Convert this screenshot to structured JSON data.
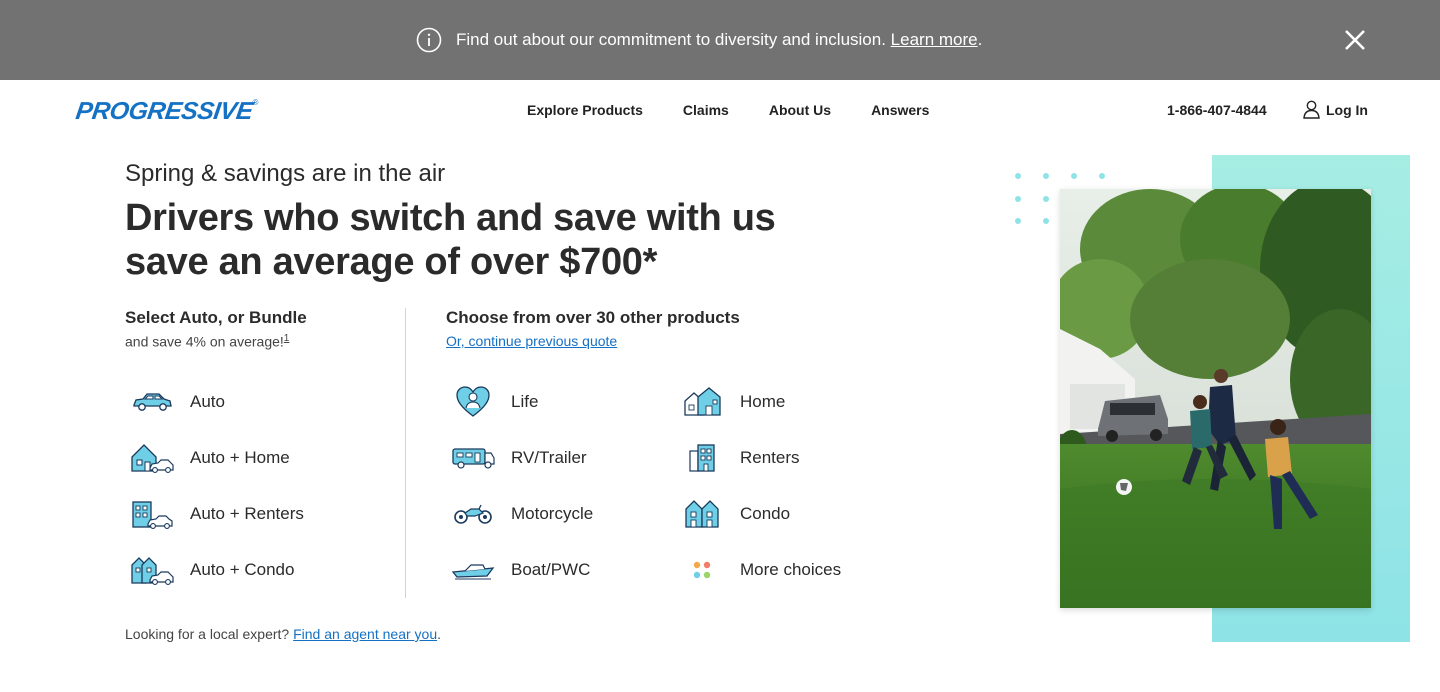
{
  "banner": {
    "message": "Find out about our commitment to diversity and inclusion.",
    "link": "Learn more",
    "trail": "."
  },
  "header": {
    "logo": "PROGRESSIVE",
    "nav": [
      "Explore Products",
      "Claims",
      "About Us",
      "Answers"
    ],
    "phone": "1-866-407-4844",
    "login": "Log In"
  },
  "hero": {
    "eyebrow": "Spring & savings are in the air",
    "headline": "Drivers who switch and save with us save an average of over $700*"
  },
  "bundle": {
    "title": "Select Auto, or Bundle",
    "subtitle": "and save 4% on average!",
    "footnote": "1",
    "items": [
      "Auto",
      "Auto + Home",
      "Auto + Renters",
      "Auto + Condo"
    ]
  },
  "other": {
    "title": "Choose from over 30 other products",
    "link": "Or, continue previous quote",
    "col1": [
      "Life",
      "RV/Trailer",
      "Motorcycle",
      "Boat/PWC"
    ],
    "col2": [
      "Home",
      "Renters",
      "Condo",
      "More choices"
    ]
  },
  "local": {
    "text": "Looking for a local expert?",
    "link": "Find an agent near you",
    "trail": "."
  },
  "colors": {
    "brand": "#1571c4",
    "banner": "#727272",
    "teal": "#a6ede4"
  }
}
